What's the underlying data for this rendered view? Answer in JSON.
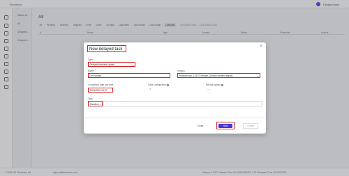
{
  "topbar": {
    "brand": "Ttimesbox",
    "action": "Delayed task"
  },
  "side": {
    "items": [
      "Status 10",
      "All",
      "Delayed t...",
      "Delayed t..."
    ]
  },
  "main": {
    "title": "All",
    "filters": [
      "All",
      "Pending",
      "Running",
      "Stopped",
      "Error",
      "Done",
      "30 days",
      "Last week",
      "Last month",
      "Last month",
      "Last year"
    ],
    "range": "12/1/2024 23:52 → 12/31/2024 23:52",
    "columns": [
      "#",
      "Name",
      "Type",
      "Created",
      "Status",
      "Scheduled",
      "Actions"
    ]
  },
  "modal": {
    "title": "New delayed task",
    "type_label": "Type",
    "type_value": "Delayed firmware update",
    "name_label": "Name",
    "name_value": "Gen update",
    "version_label": "Version",
    "version_value": "firmware-sup-3.23.07-release-18 base-certified-legacy",
    "time_label": "Completion date and time",
    "time_value": "12/31/2024 04:10",
    "save_label": "Save configuration",
    "save_check": "✓",
    "reboot_label": "Reboot system",
    "reboot_value": "—",
    "tags_label": "Tags",
    "tag_value": "Sandbox",
    "tag_remove": "×",
    "close_icon": "×",
    "buttons": {
      "close": "Close",
      "next": "Next",
      "create": "Create"
    }
  },
  "footer": {
    "left": "© 2024 ISS Ttimesbox Ltd.",
    "mid": "support@ttimesbox.com",
    "right": "Version: 1.23.07 release-18 on 03.15 REVERSE / 1.23 Firmware 03 on 03 TRVERSE"
  }
}
